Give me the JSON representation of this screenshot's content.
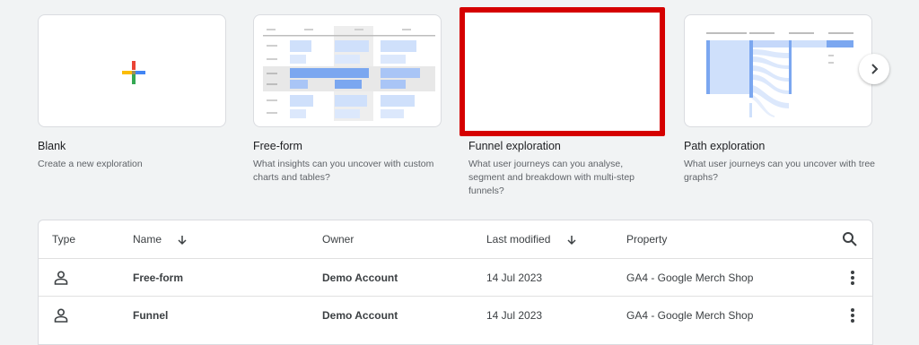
{
  "templates": [
    {
      "title": "Blank",
      "description": "Create a new exploration",
      "icon": "plus-icon"
    },
    {
      "title": "Free-form",
      "description": "What insights can you uncover with custom charts and tables?"
    },
    {
      "title": "Funnel exploration",
      "description": "What user journeys can you analyse, segment and breakdown with multi-step funnels?"
    },
    {
      "title": "Path exploration",
      "description": "What user journeys can you uncover with tree graphs?"
    }
  ],
  "carousel": {
    "next_icon": "chevron-right-icon"
  },
  "table": {
    "headers": {
      "type": "Type",
      "name": "Name",
      "owner": "Owner",
      "last_modified": "Last modified",
      "property": "Property"
    },
    "search_icon": "search-icon",
    "rows": [
      {
        "type_icon": "person-icon",
        "name": "Free-form",
        "owner": "Demo Account",
        "last_modified": "14 Jul 2023",
        "property": "GA4 - Google Merch Shop"
      },
      {
        "type_icon": "person-icon",
        "name": "Funnel",
        "owner": "Demo Account",
        "last_modified": "14 Jul 2023",
        "property": "GA4 - Google Merch Shop"
      }
    ]
  },
  "colors": {
    "accent_blue": "#7ba7f0",
    "selection_red": "#d50000"
  }
}
